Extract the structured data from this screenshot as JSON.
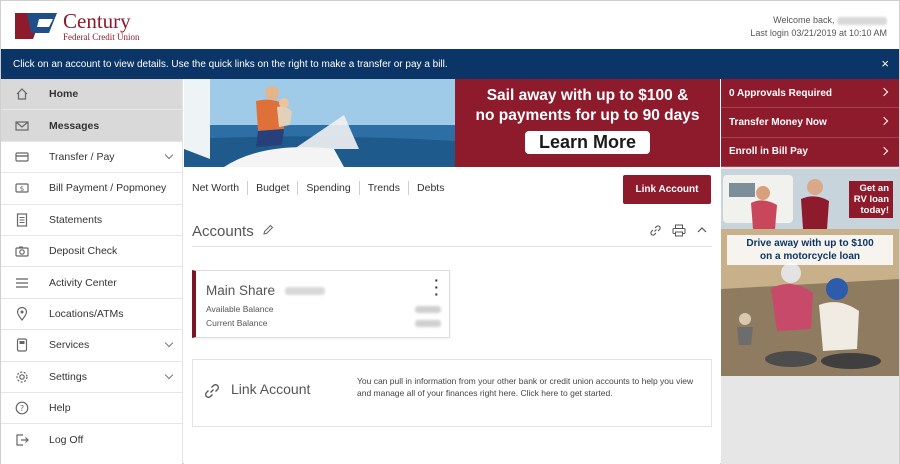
{
  "header": {
    "logo_name": "Century",
    "logo_sub": "Federal Credit Union",
    "welcome": "Welcome back,",
    "last_login": "Last login 03/21/2019 at 10:10 AM"
  },
  "notice": {
    "text": "Click on an account to view details. Use the quick links on the right to make a transfer or pay a bill.",
    "close": "×"
  },
  "sidebar": {
    "items": [
      {
        "label": "Home",
        "icon": "home-icon"
      },
      {
        "label": "Messages",
        "icon": "envelope-icon"
      },
      {
        "label": "Transfer / Pay",
        "icon": "card-icon"
      },
      {
        "label": "Bill Payment / Popmoney",
        "icon": "money-icon"
      },
      {
        "label": "Statements",
        "icon": "document-icon"
      },
      {
        "label": "Deposit Check",
        "icon": "camera-icon"
      },
      {
        "label": "Activity Center",
        "icon": "list-icon"
      },
      {
        "label": "Locations/ATMs",
        "icon": "map-pin-icon"
      },
      {
        "label": "Services",
        "icon": "services-icon"
      },
      {
        "label": "Settings",
        "icon": "gear-icon"
      },
      {
        "label": "Help",
        "icon": "help-icon"
      },
      {
        "label": "Log Off",
        "icon": "logout-icon"
      }
    ]
  },
  "banner": {
    "headline_1": "Sail away with up to $100 &",
    "headline_2": "no payments for up to 90 days",
    "button": "Learn More"
  },
  "tabs": [
    "Net Worth",
    "Budget",
    "Spending",
    "Trends",
    "Debts"
  ],
  "link_account_button": "Link Account",
  "accounts": {
    "title": "Accounts",
    "card": {
      "name": "Main Share",
      "available_label": "Available Balance",
      "current_label": "Current Balance"
    }
  },
  "link_panel": {
    "title": "Link Account",
    "description": "You can pull in information from your other bank or credit union accounts to help you view and manage all of your finances right here. Click here to get started."
  },
  "quick_links": [
    "0 Approvals Required",
    "Transfer Money Now",
    "Enroll in Bill Pay"
  ],
  "ad": {
    "rv_line_1": "Get an",
    "rv_line_2": "RV loan",
    "rv_line_3": "today!",
    "moto_line_1": "Drive away with up to $100",
    "moto_line_2": "on a motorcycle loan"
  },
  "colors": {
    "brand_red": "#8e1b2c",
    "navy": "#0b3566"
  }
}
